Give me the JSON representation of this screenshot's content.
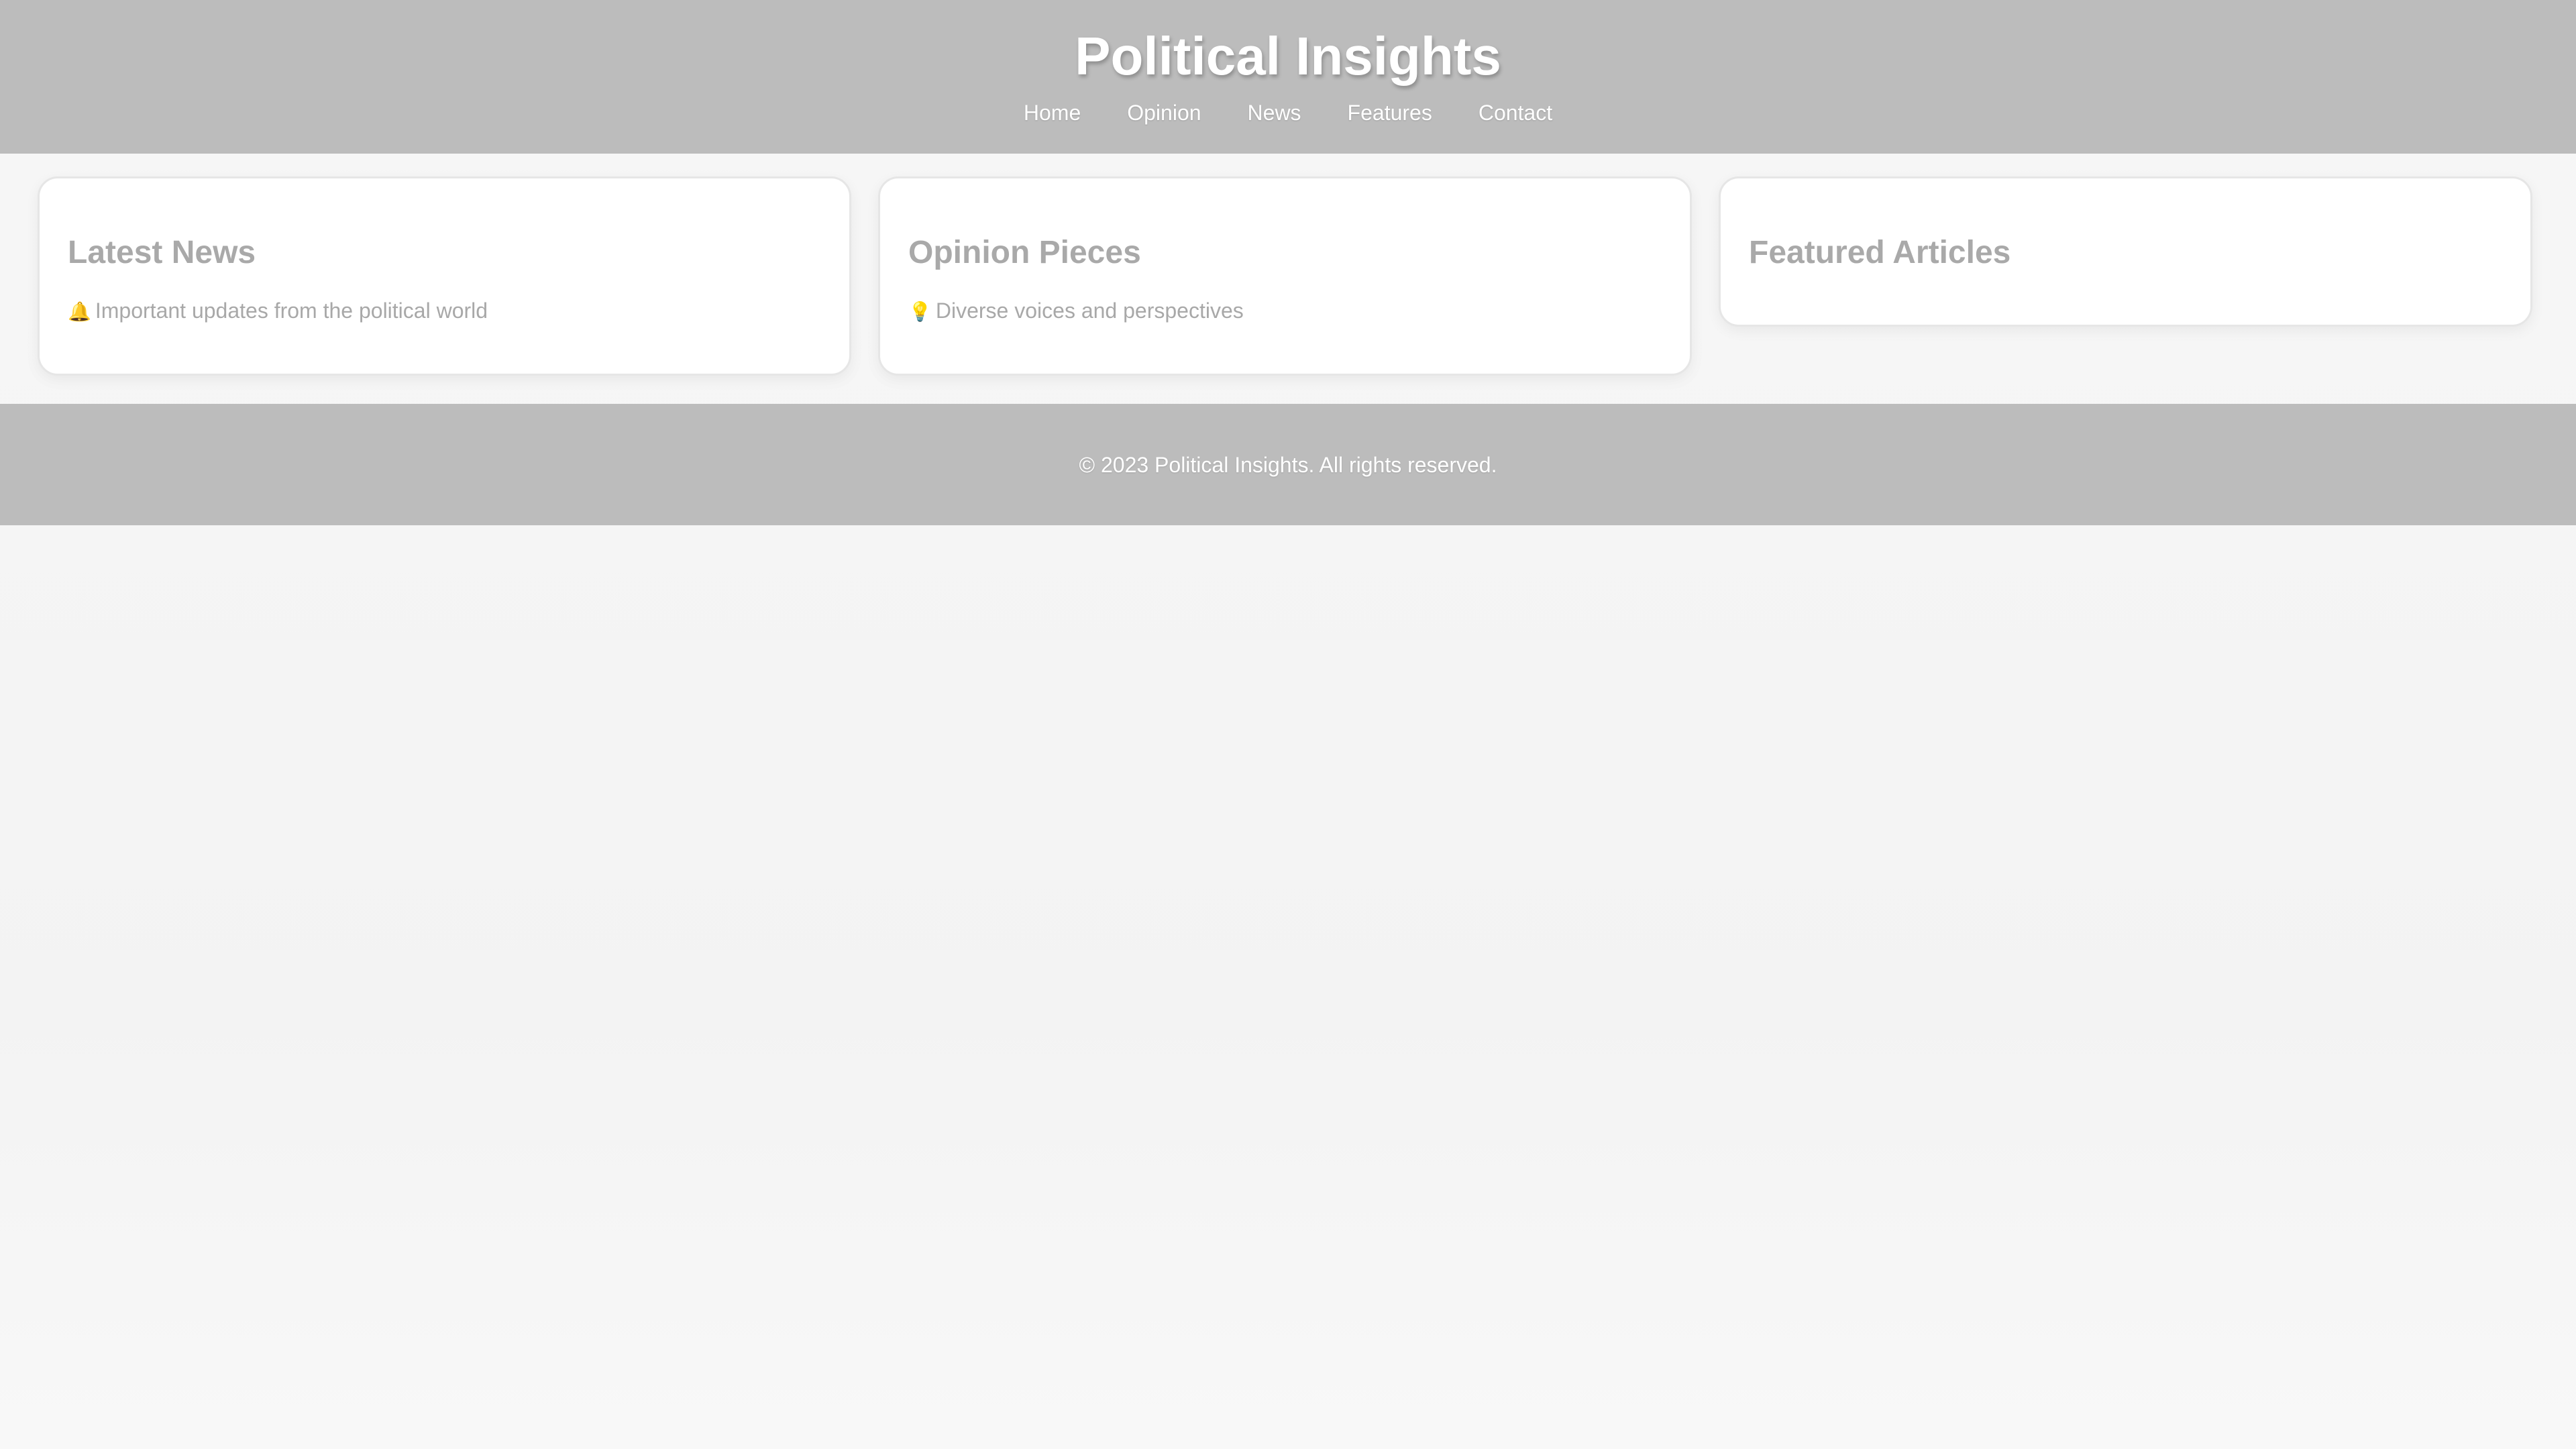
{
  "header": {
    "title": "Political Insights",
    "nav": [
      {
        "label": "Home"
      },
      {
        "label": "Opinion"
      },
      {
        "label": "News"
      },
      {
        "label": "Features"
      },
      {
        "label": "Contact"
      }
    ]
  },
  "cards": [
    {
      "title": "Latest News",
      "icon": "bell-icon",
      "icon_glyph": "🔔",
      "text": "Important updates from the political world"
    },
    {
      "title": "Opinion Pieces",
      "icon": "lightbulb-icon",
      "icon_glyph": "💡",
      "text": "Diverse voices and perspectives"
    },
    {
      "title": "Featured Articles"
    }
  ],
  "footer": {
    "text": "© 2023 Political Insights. All rights reserved."
  },
  "colors": {
    "header_bg": "#bcbcbc",
    "page_bg": "#f5f5f5",
    "card_bg": "#ffffff",
    "muted_text": "#a9a9a9"
  }
}
